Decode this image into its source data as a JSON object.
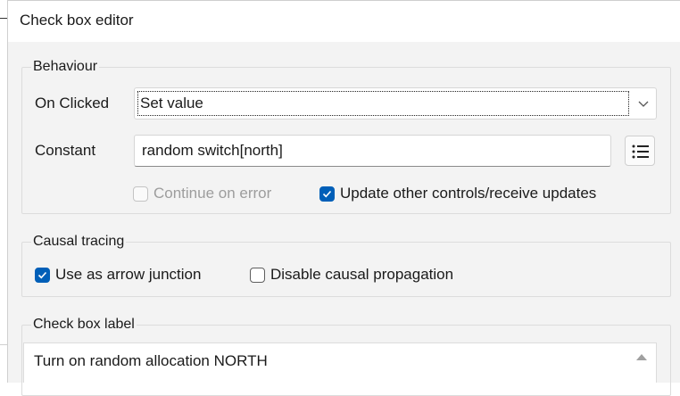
{
  "window": {
    "title": "Check box editor"
  },
  "behaviour": {
    "legend": "Behaviour",
    "on_clicked_label": "On Clicked",
    "on_clicked_value": "Set value",
    "constant_label": "Constant",
    "constant_value": "random switch[north]",
    "continue_on_error": {
      "label": "Continue on error",
      "checked": false,
      "enabled": false
    },
    "update_other_controls": {
      "label": "Update other controls/receive updates",
      "checked": true,
      "enabled": true
    }
  },
  "causal_tracing": {
    "legend": "Causal tracing",
    "use_as_arrow_junction": {
      "label": "Use as arrow junction",
      "checked": true
    },
    "disable_causal_propagation": {
      "label": "Disable causal propagation",
      "checked": false
    }
  },
  "check_box_label": {
    "legend": "Check box label",
    "text": "Turn on random allocation NORTH"
  },
  "icons": {
    "dropdown": "chevron-down-icon",
    "list": "list-icon",
    "checkmark": "checkmark-icon",
    "scroll": "scroll-up-arrow-icon"
  },
  "colors": {
    "accent": "#005fb8",
    "dialog_bg": "#f3f3f3",
    "titlebar_bg": "#ffffff",
    "disabled_text": "#9d9d9d"
  }
}
